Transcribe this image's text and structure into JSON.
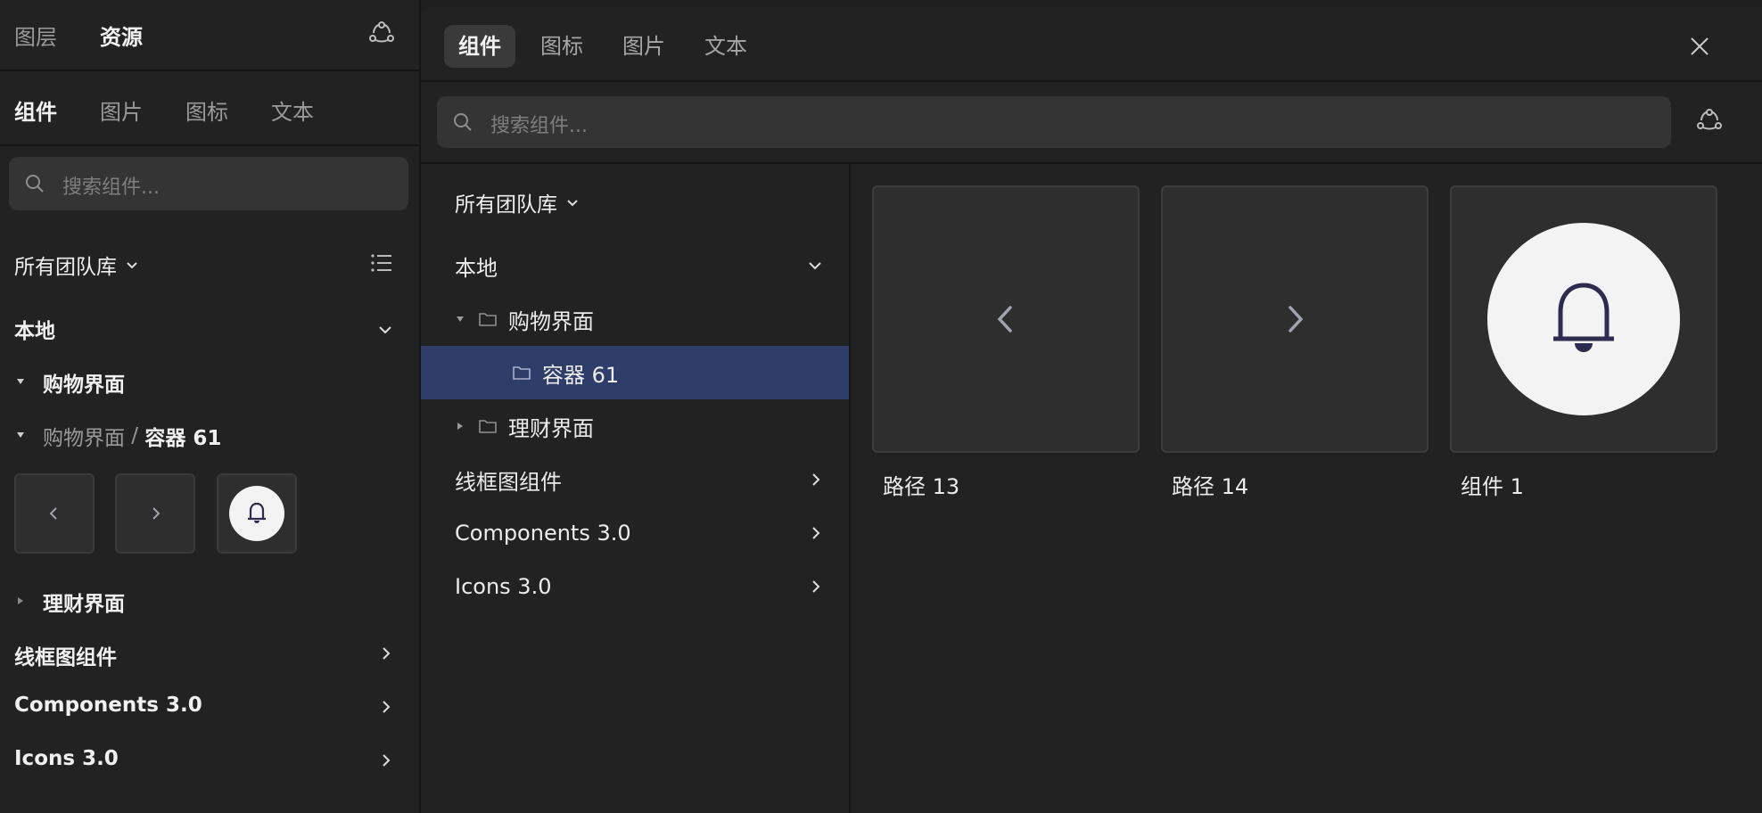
{
  "left": {
    "top_tabs": [
      "图层",
      "资源"
    ],
    "sub_tabs": [
      "组件",
      "图片",
      "图标",
      "文本"
    ],
    "search_placeholder": "搜索组件...",
    "library_selector": "所有团队库",
    "local_label": "本地",
    "folder_shopping": "购物界面",
    "breadcrumb_parent": "购物界面",
    "breadcrumb_sep": " / ",
    "breadcrumb_current": "容器 61",
    "folder_finance": "理财界面",
    "sections": [
      "线框图组件",
      "Components 3.0",
      "Icons 3.0"
    ]
  },
  "right": {
    "tabs": [
      "组件",
      "图标",
      "图片",
      "文本"
    ],
    "search_placeholder": "搜索组件...",
    "library_selector": "所有团队库",
    "tree": {
      "local": "本地",
      "shopping": "购物界面",
      "container": "容器 61",
      "finance": "理财界面"
    },
    "sections": [
      "线框图组件",
      "Components 3.0",
      "Icons 3.0"
    ],
    "components": [
      {
        "name": "路径 13",
        "icon": "chevron-left-icon"
      },
      {
        "name": "路径 14",
        "icon": "chevron-right-icon"
      },
      {
        "name": "组件 1",
        "icon": "bell-icon"
      }
    ]
  },
  "colors": {
    "selected_row": "#2f3d69",
    "bell_color": "#2d2b4f"
  }
}
